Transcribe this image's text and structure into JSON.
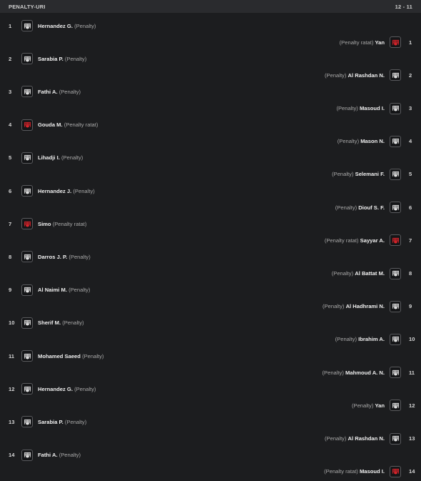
{
  "header": {
    "title": "PENALTY-URI",
    "score": "12 - 11"
  },
  "colors": {
    "scored": "#e8e8e8",
    "missed": "#e0242b",
    "background": "#1c1d1f",
    "header_bg": "#2a2b2e"
  },
  "icons": {
    "scored": "penalty-scored-icon",
    "missed": "penalty-missed-icon"
  },
  "kicks": [
    {
      "side": "home",
      "number": "1",
      "name": "Hernandez G.",
      "tag": "(Penalty)",
      "missed": false
    },
    {
      "side": "away",
      "number": "1",
      "name": "Yan",
      "tag": "(Penalty ratat)",
      "missed": true
    },
    {
      "side": "home",
      "number": "2",
      "name": "Sarabia P.",
      "tag": "(Penalty)",
      "missed": false
    },
    {
      "side": "away",
      "number": "2",
      "name": "Al Rashdan N.",
      "tag": "(Penalty)",
      "missed": false
    },
    {
      "side": "home",
      "number": "3",
      "name": "Fathi A.",
      "tag": "(Penalty)",
      "missed": false
    },
    {
      "side": "away",
      "number": "3",
      "name": "Masoud I.",
      "tag": "(Penalty)",
      "missed": false
    },
    {
      "side": "home",
      "number": "4",
      "name": "Gouda M.",
      "tag": "(Penalty ratat)",
      "missed": true
    },
    {
      "side": "away",
      "number": "4",
      "name": "Mason N.",
      "tag": "(Penalty)",
      "missed": false
    },
    {
      "side": "home",
      "number": "5",
      "name": "Lihadji I.",
      "tag": "(Penalty)",
      "missed": false
    },
    {
      "side": "away",
      "number": "5",
      "name": "Selemani F.",
      "tag": "(Penalty)",
      "missed": false
    },
    {
      "side": "home",
      "number": "6",
      "name": "Hernandez J.",
      "tag": "(Penalty)",
      "missed": false
    },
    {
      "side": "away",
      "number": "6",
      "name": "Diouf S. F.",
      "tag": "(Penalty)",
      "missed": false
    },
    {
      "side": "home",
      "number": "7",
      "name": "Simo",
      "tag": "(Penalty ratat)",
      "missed": true
    },
    {
      "side": "away",
      "number": "7",
      "name": "Sayyar A.",
      "tag": "(Penalty ratat)",
      "missed": true
    },
    {
      "side": "home",
      "number": "8",
      "name": "Darros J. P.",
      "tag": "(Penalty)",
      "missed": false
    },
    {
      "side": "away",
      "number": "8",
      "name": "Al Battat M.",
      "tag": "(Penalty)",
      "missed": false
    },
    {
      "side": "home",
      "number": "9",
      "name": "Al Naimi M.",
      "tag": "(Penalty)",
      "missed": false
    },
    {
      "side": "away",
      "number": "9",
      "name": "Al Hadhrami N.",
      "tag": "(Penalty)",
      "missed": false
    },
    {
      "side": "home",
      "number": "10",
      "name": "Sherif M.",
      "tag": "(Penalty)",
      "missed": false
    },
    {
      "side": "away",
      "number": "10",
      "name": "Ibrahim A.",
      "tag": "(Penalty)",
      "missed": false
    },
    {
      "side": "home",
      "number": "11",
      "name": "Mohamed Saeed",
      "tag": "(Penalty)",
      "missed": false
    },
    {
      "side": "away",
      "number": "11",
      "name": "Mahmoud A. N.",
      "tag": "(Penalty)",
      "missed": false
    },
    {
      "side": "home",
      "number": "12",
      "name": "Hernandez G.",
      "tag": "(Penalty)",
      "missed": false
    },
    {
      "side": "away",
      "number": "12",
      "name": "Yan",
      "tag": "(Penalty)",
      "missed": false
    },
    {
      "side": "home",
      "number": "13",
      "name": "Sarabia P.",
      "tag": "(Penalty)",
      "missed": false
    },
    {
      "side": "away",
      "number": "13",
      "name": "Al Rashdan N.",
      "tag": "(Penalty)",
      "missed": false
    },
    {
      "side": "home",
      "number": "14",
      "name": "Fathi A.",
      "tag": "(Penalty)",
      "missed": false
    },
    {
      "side": "away",
      "number": "14",
      "name": "Masoud I.",
      "tag": "(Penalty ratat)",
      "missed": true
    }
  ]
}
